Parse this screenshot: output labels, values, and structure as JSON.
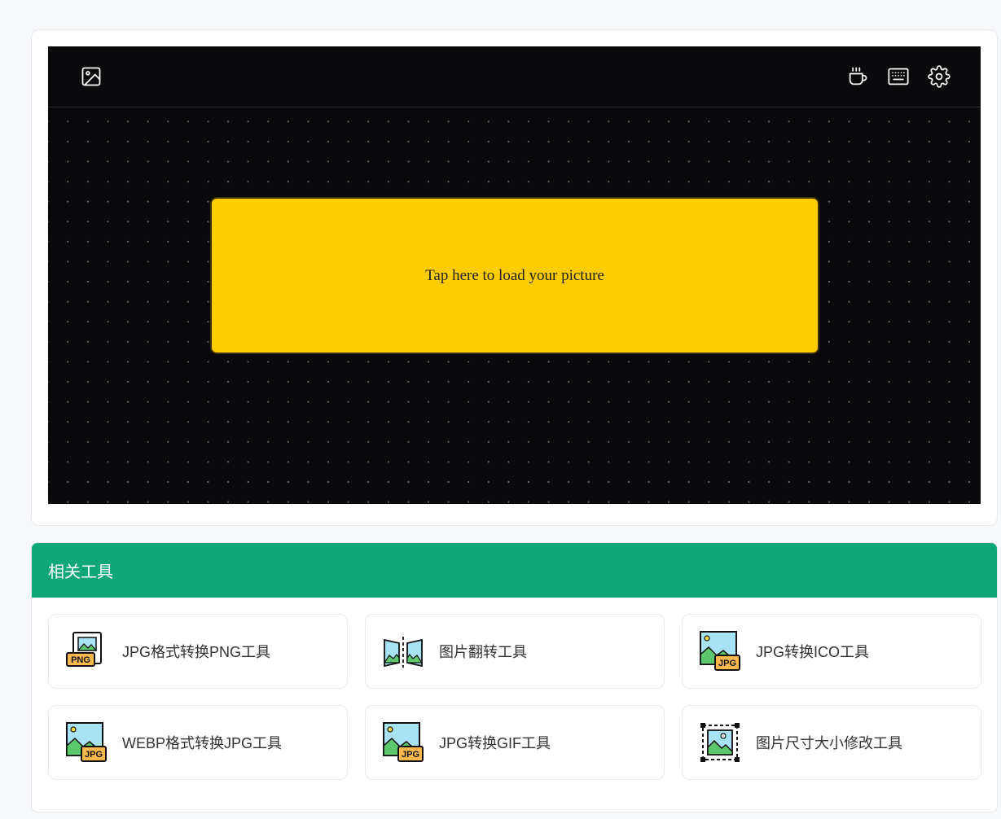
{
  "editor": {
    "toolbar": {
      "left_icons": [
        "image-icon"
      ],
      "right_icons": [
        "coffee-icon",
        "keyboard-icon",
        "settings-icon"
      ]
    },
    "upload_prompt": "Tap here to load your picture",
    "colors": {
      "stage_bg": "#0a0a0c",
      "upload_bg": "#ffcc00"
    }
  },
  "related_tools": {
    "title": "相关工具",
    "header_color": "#10a778",
    "items": [
      {
        "label": "JPG格式转换PNG工具",
        "icon": "png-file-icon"
      },
      {
        "label": "图片翻转工具",
        "icon": "flip-image-icon"
      },
      {
        "label": "JPG转换ICO工具",
        "icon": "jpg-image-icon"
      },
      {
        "label": "WEBP格式转换JPG工具",
        "icon": "jpg-image-icon"
      },
      {
        "label": "JPG转换GIF工具",
        "icon": "jpg-image-icon"
      },
      {
        "label": "图片尺寸大小修改工具",
        "icon": "resize-image-icon"
      }
    ]
  }
}
